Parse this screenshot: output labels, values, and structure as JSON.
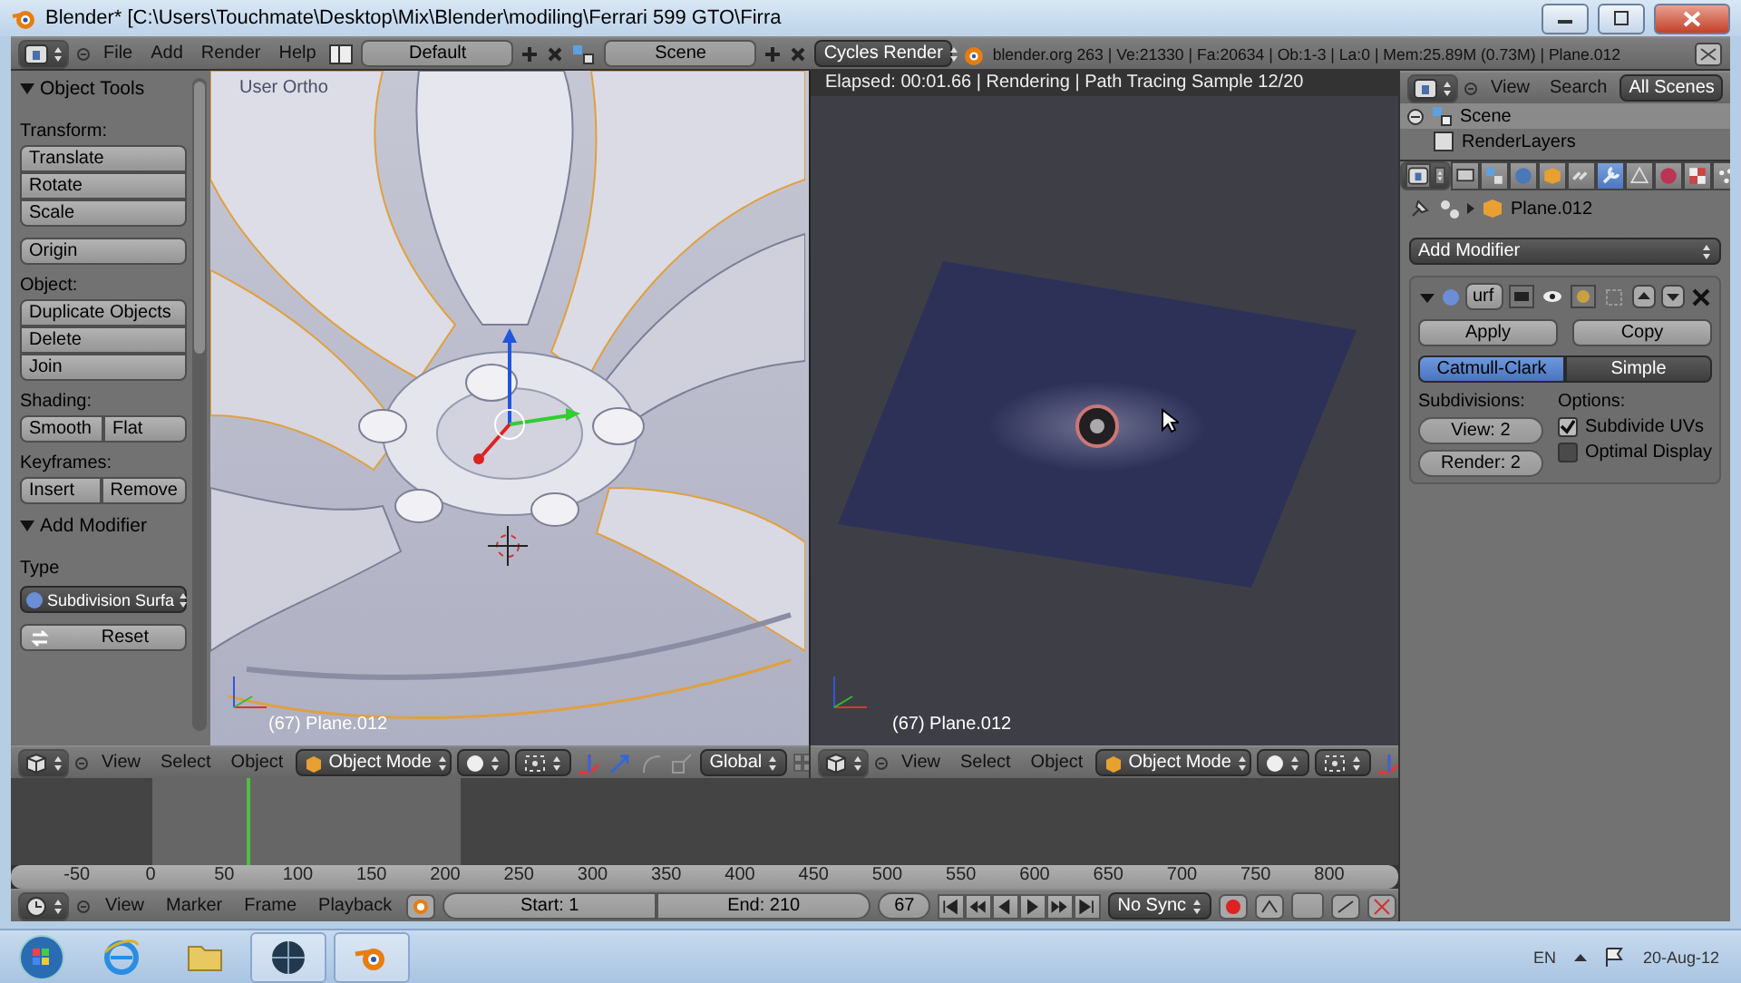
{
  "window": {
    "title": "Blender* [C:\\Users\\Touchmate\\Desktop\\Mix\\Blender\\modiling\\Ferrari 599 GTO\\Firra"
  },
  "info_header": {
    "menus": [
      "File",
      "Add",
      "Render",
      "Help"
    ],
    "layout": "Default",
    "scene": "Scene",
    "engine": "Cycles Render",
    "stats": "blender.org 263 | Ve:21330 | Fa:20634 | Ob:1-3 | La:0 | Mem:25.89M (0.73M) | Plane.012"
  },
  "tool_shelf": {
    "panels": [
      {
        "title": "Object Tools",
        "expanded": true,
        "groups": [
          {
            "label": "Transform:",
            "rows": [
              [
                "Translate"
              ],
              [
                "Rotate"
              ],
              [
                "Scale"
              ]
            ]
          },
          {
            "rows": [
              [
                "Origin"
              ]
            ]
          },
          {
            "label": "Object:",
            "rows": [
              [
                "Duplicate Objects"
              ],
              [
                "Delete"
              ],
              [
                "Join"
              ]
            ]
          },
          {
            "label": "Shading:",
            "rows": [
              [
                "Smooth",
                "Flat"
              ]
            ]
          },
          {
            "label": "Keyframes:",
            "rows": [
              [
                "Insert",
                "Remove"
              ]
            ]
          }
        ]
      }
    ],
    "operator": {
      "title": "Add Modifier",
      "expanded": true,
      "type_label": "Type",
      "type_value": "Subdivision Surfa",
      "reset": "Reset"
    }
  },
  "viewport_3d": {
    "view_label": "User Ortho",
    "object_label": "(67) Plane.012",
    "header": {
      "menus": [
        "View",
        "Select",
        "Object"
      ],
      "mode": "Object Mode",
      "orientation": "Global"
    }
  },
  "render_view": {
    "status": "Elapsed: 00:01.66 | Rendering | Path Tracing Sample 12/20",
    "object_label": "(67) Plane.012",
    "header": {
      "menus": [
        "View",
        "Select",
        "Object"
      ],
      "mode": "Object Mode"
    }
  },
  "outliner": {
    "menus": [
      "View",
      "Search"
    ],
    "filter": "All Scenes",
    "items": [
      {
        "label": "Scene",
        "expanded": true,
        "children": [
          {
            "label": "RenderLayers"
          }
        ]
      }
    ]
  },
  "properties": {
    "tabs": [
      {
        "kind": "render",
        "selected": false
      },
      {
        "kind": "scene",
        "selected": false
      },
      {
        "kind": "world",
        "selected": false
      },
      {
        "kind": "object",
        "selected": false
      },
      {
        "kind": "constraints",
        "selected": false
      },
      {
        "kind": "modifiers",
        "selected": true
      },
      {
        "kind": "data",
        "selected": false
      },
      {
        "kind": "material",
        "selected": false
      },
      {
        "kind": "texture",
        "selected": false
      },
      {
        "kind": "particles",
        "selected": false
      }
    ],
    "context": "Plane.012",
    "add_modifier": "Add Modifier",
    "modifier": {
      "name": "urf",
      "expanded": true,
      "apply": "Apply",
      "copy": "Copy",
      "subdivision_types": [
        {
          "label": "Catmull-Clark",
          "selected": true
        },
        {
          "label": "Simple",
          "selected": false
        }
      ],
      "subdivisions_label": "Subdivisions:",
      "view": "View: 2",
      "render": "Render: 2",
      "options_label": "Options:",
      "options": [
        {
          "label": "Subdivide UVs",
          "checked": true
        },
        {
          "label": "Optimal Display",
          "checked": false
        }
      ]
    }
  },
  "timeline": {
    "ticks": [
      "-50",
      "0",
      "50",
      "100",
      "150",
      "200",
      "250",
      "300",
      "350",
      "400",
      "450",
      "500",
      "550",
      "600",
      "650",
      "700",
      "750",
      "800"
    ],
    "header": {
      "menus": [
        "View",
        "Marker",
        "Frame",
        "Playback"
      ],
      "start": "Start: 1",
      "end": "End: 210",
      "current": "67",
      "sync": "No Sync"
    }
  },
  "taskbar": {
    "apps": [
      {
        "kind": "browser"
      },
      {
        "kind": "folder"
      },
      {
        "kind": "globe"
      },
      {
        "kind": "blender"
      }
    ],
    "language": "EN",
    "date": "20-Aug-12"
  }
}
